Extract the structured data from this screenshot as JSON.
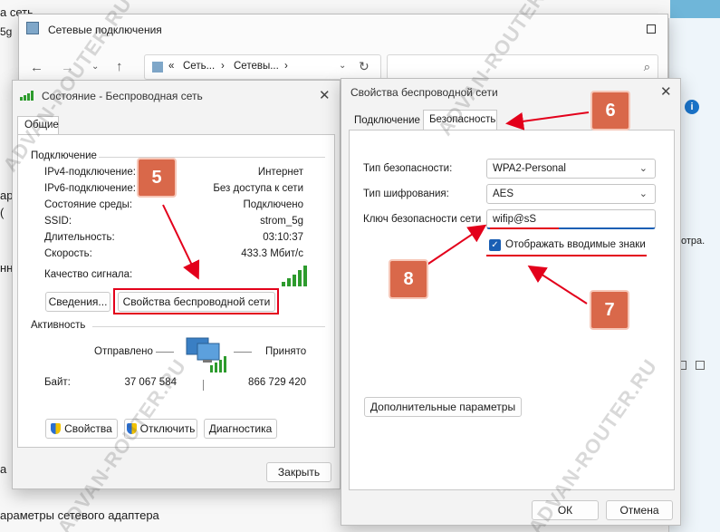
{
  "bg_window": {
    "top_left_label": "а сеть",
    "sidebar_snippet": "5g",
    "left_side_text": [
      "ар",
      "нн",
      "(",
      "а"
    ],
    "bottom_left_text": "араметры сетевого адаптера",
    "right_side_text": "отра."
  },
  "network_connections": {
    "title": "Сетевые подключения",
    "address": [
      "Сеть...",
      "Сетевы..."
    ],
    "address_separator": "›",
    "address_prefix": "«"
  },
  "status_dialog": {
    "title": "Состояние - Беспроводная сеть",
    "tab": "Общие",
    "connection_section": "Подключение",
    "rows": [
      {
        "label": "IPv4-подключение:",
        "value": "Интернет"
      },
      {
        "label": "IPv6-подключение:",
        "value": "Без доступа к сети"
      },
      {
        "label": "Состояние среды:",
        "value": "Подключено"
      },
      {
        "label": "SSID:",
        "value": "strom_5g"
      },
      {
        "label": "Длительность:",
        "value": "03:10:37"
      },
      {
        "label": "Скорость:",
        "value": "433.3 Мбит/с"
      }
    ],
    "signal_label": "Качество сигнала:",
    "details_button": "Сведения...",
    "wireless_props_button": "Свойства беспроводной сети",
    "activity_section": "Активность",
    "sent_label": "Отправлено",
    "received_label": "Принято",
    "bytes_label": "Байт:",
    "bytes_sent": "37 067 584",
    "bytes_received": "866 729 420",
    "properties_button": "Свойства",
    "disable_button": "Отключить",
    "diagnostics_button": "Диагностика",
    "close_button": "Закрыть"
  },
  "wireless_props": {
    "title": "Свойства беспроводной сети",
    "tabs": [
      "Подключение",
      "Безопасность"
    ],
    "active_tab": "Безопасность",
    "security_type_label": "Тип безопасности:",
    "security_type_value": "WPA2-Personal",
    "encryption_label": "Тип шифрования:",
    "encryption_value": "AES",
    "key_label": "Ключ безопасности сети",
    "key_value": "wifip@sS",
    "show_chars_label": "Отображать вводимые знаки",
    "show_chars_checked": true,
    "advanced_button": "Дополнительные параметры",
    "ok_button": "ОК",
    "cancel_button": "Отмена"
  },
  "annotations": {
    "badges": [
      "5",
      "6",
      "7",
      "8"
    ],
    "accent_color": "#e3001b",
    "badge_color": "#d9684a"
  },
  "watermark": "ADVAN-ROUTER.RU"
}
